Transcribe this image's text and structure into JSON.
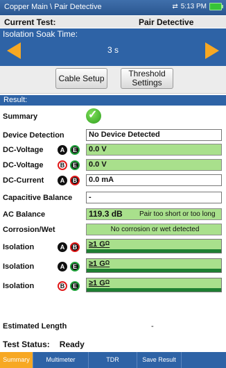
{
  "statusbar": {
    "path": "Copper Main \\ Pair Detective",
    "time": "5:13 PM"
  },
  "current_test": {
    "label": "Current Test:",
    "value": "Pair Detective"
  },
  "soak": {
    "title": "Isolation Soak Time:",
    "value": "3 s"
  },
  "buttons": {
    "cable_setup": "Cable Setup",
    "threshold_line1": "Threshold",
    "threshold_line2": "Settings"
  },
  "result": {
    "header": "Result:",
    "summary_label": "Summary",
    "device_detection_label": "Device Detection",
    "device_detection_value": "No Device Detected",
    "dc_voltage_label": "DC-Voltage",
    "dc_voltage_1": "0.0 V",
    "dc_voltage_2": "0.0 V",
    "dc_current_label": "DC-Current",
    "dc_current": "0.0 mA",
    "cap_balance_label": "Capacitive Balance",
    "cap_balance_value": "-",
    "ac_balance_label": "AC Balance",
    "ac_balance_value": "119.3 dB",
    "ac_balance_note": "Pair too short or too long",
    "corrosion_label": "Corrosion/Wet",
    "corrosion_value": "No corrosion or wet detected",
    "isolation_label": "Isolation",
    "isolation_1": "≥1 G",
    "isolation_2": "≥1 G",
    "isolation_3": "≥1 G",
    "ohm": "Ω",
    "est_length_label": "Estimated Length",
    "est_length_value": "-"
  },
  "test_status": {
    "label": "Test Status:",
    "value": "Ready"
  },
  "tabs": [
    "Summary",
    "Multimeter",
    "TDR",
    "Save Result"
  ],
  "circle_letters": {
    "a": "A",
    "b": "B",
    "e": "E"
  }
}
